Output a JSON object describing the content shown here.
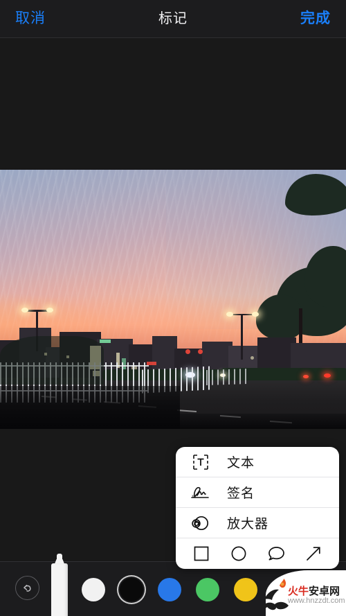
{
  "topbar": {
    "cancel_label": "取消",
    "title": "标记",
    "done_label": "完成"
  },
  "popup": {
    "items": [
      {
        "label": "文本",
        "icon": "text-box-icon"
      },
      {
        "label": "签名",
        "icon": "signature-icon"
      },
      {
        "label": "放大器",
        "icon": "magnifier-icon"
      }
    ],
    "shapes": [
      {
        "name": "square-shape-icon"
      },
      {
        "name": "circle-shape-icon"
      },
      {
        "name": "speech-bubble-shape-icon"
      },
      {
        "name": "arrow-shape-icon"
      }
    ]
  },
  "toolbar": {
    "undo_icon": "undo-icon",
    "pen_tool": "pen-tool",
    "colors": [
      {
        "name": "white",
        "hex": "#f1f1f1",
        "selected": false
      },
      {
        "name": "black",
        "hex": "#0a0a0a",
        "selected": true
      },
      {
        "name": "blue",
        "hex": "#2878e8",
        "selected": false
      },
      {
        "name": "green",
        "hex": "#4bc764",
        "selected": false
      },
      {
        "name": "yellow",
        "hex": "#f0c419",
        "selected": false
      },
      {
        "name": "red",
        "hex": "#f0283c",
        "selected": false
      }
    ]
  },
  "watermark": {
    "brand_red": "火牛",
    "brand_dark": "安卓网",
    "url": "www.hnzzdt.com"
  },
  "colors": {
    "accent": "#1a7ffa",
    "bar_bg": "#1c1c1e",
    "canvas_bg": "#191919",
    "popup_bg": "#ffffff"
  }
}
